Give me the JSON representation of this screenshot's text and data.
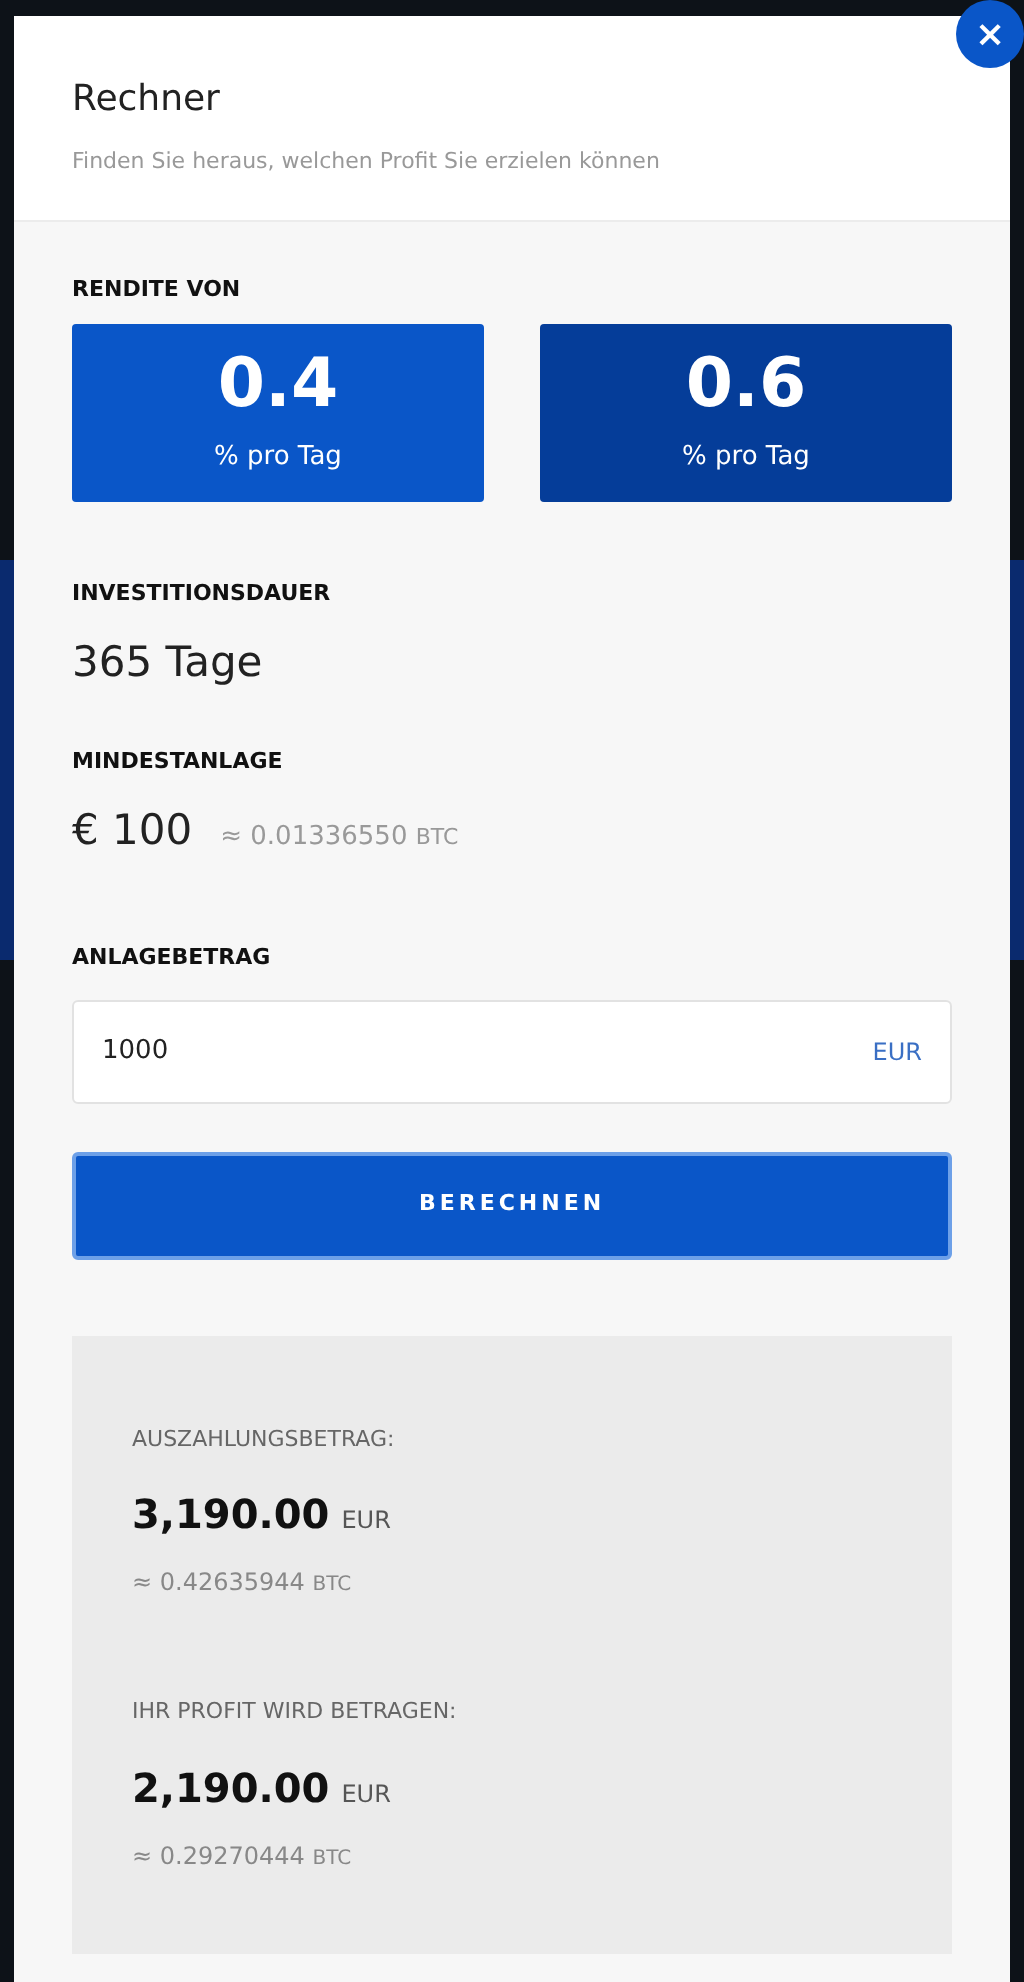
{
  "modal": {
    "title": "Rechner",
    "subtitle": "Finden Sie heraus, welchen Profit Sie erzielen können",
    "close_label": "×"
  },
  "rate": {
    "label": "RENDITE VON",
    "options": [
      {
        "value": "0.4",
        "unit": "% pro Tag",
        "selected": true
      },
      {
        "value": "0.6",
        "unit": "% pro Tag",
        "selected": false
      }
    ]
  },
  "duration": {
    "label": "INVESTITIONSDAUER",
    "value": "365 Tage"
  },
  "minimum": {
    "label": "MINDESTANLAGE",
    "value": "€ 100",
    "approx": "≈ 0.01336550",
    "approx_unit": "BTC"
  },
  "amount": {
    "label": "ANLAGEBETRAG",
    "value": "1000",
    "currency": "EUR"
  },
  "submit": "BERECHNEN",
  "results": [
    {
      "label": "AUSZAHLUNGSBETRAG:",
      "value": "3,190.00",
      "unit": "EUR",
      "approx": "≈ 0.42635944",
      "approx_unit": "BTC"
    },
    {
      "label": "IHR PROFIT WIRD BETRAGEN:",
      "value": "2,190.00",
      "unit": "EUR",
      "approx": "≈ 0.29270444",
      "approx_unit": "BTC"
    }
  ]
}
